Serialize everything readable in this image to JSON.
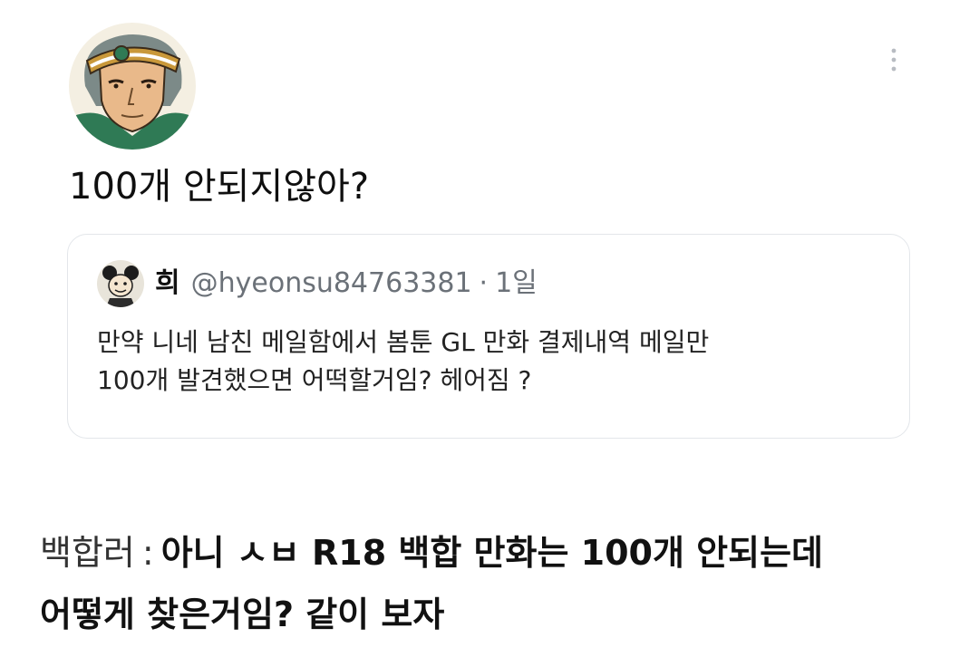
{
  "tweet": {
    "text": "100개 안되지않아?",
    "avatar_icon": "anime-character-avatar",
    "menu_icon": "more-vertical-icon"
  },
  "quote": {
    "author_name": "희",
    "handle": "@hyeonsu84763381",
    "separator": "·",
    "time": "1일",
    "avatar_icon": "cartoon-avatar",
    "body_lines": [
      "만약 니네 남친 메일함에서 봄툰 GL 만화 결제내역 메일만",
      "100개 발견했으면 어떡할거임? 헤어짐 ?"
    ]
  },
  "comment": {
    "author": "백합러",
    "colon": ":",
    "line1": "아니 ㅅㅂ  R18 백합 만화는 100개 안되는데",
    "line2": "어떻게 찾은거임? 같이 보자"
  },
  "colors": {
    "text": "#111111",
    "muted": "#6b7178",
    "card_border": "#e3e6ea",
    "avatar_green": "#2f7a55",
    "avatar_gold": "#b98a2a"
  }
}
